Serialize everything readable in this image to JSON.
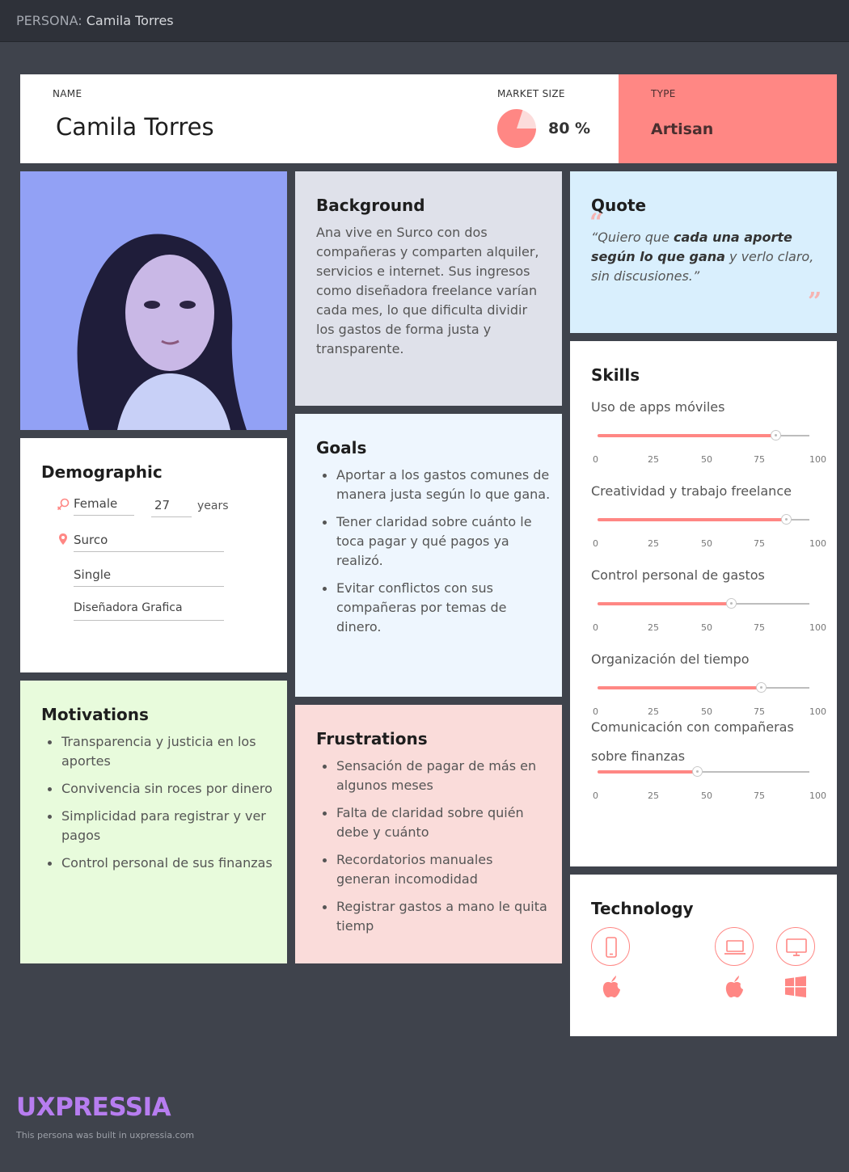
{
  "topbar": {
    "prefix": "PERSONA:",
    "name": "Camila Torres"
  },
  "header": {
    "name_label": "NAME",
    "name_value": "Camila Torres",
    "market_label": "MARKET SIZE",
    "market_value": "80 %",
    "market_percent": 80,
    "type_label": "TYPE",
    "type_value": "Artisan"
  },
  "background": {
    "title": "Background",
    "text": "Ana vive en Surco con dos compañeras y comparten alquiler, servicios e internet. Sus ingresos como diseñadora freelance varían cada mes, lo que dificulta dividir los gastos de forma justa y transparente."
  },
  "quote": {
    "title": "Quote",
    "part1": "“Quiero que ",
    "bold": "cada una aporte según lo que gana",
    "part2": " y verlo claro, sin discusiones.”"
  },
  "demographic": {
    "title": "Demographic",
    "gender": "Female",
    "age": "27",
    "age_unit": "years",
    "location": "Surco",
    "status": "Single",
    "occupation": "Diseñadora Grafica"
  },
  "goals": {
    "title": "Goals",
    "items": [
      "Aportar a los gastos comunes de manera justa según lo que gana.",
      "Tener claridad sobre cuánto le toca pagar y qué pagos ya realizó.",
      "Evitar conflictos con sus compañeras por temas de dinero."
    ]
  },
  "skills": {
    "title": "Skills",
    "ticks": [
      "0",
      "25",
      "50",
      "75",
      "100"
    ],
    "items": [
      {
        "label": "Uso de apps móviles",
        "value": 84
      },
      {
        "label": "Creatividad y trabajo freelance",
        "value": 89
      },
      {
        "label": "Control personal de gastos",
        "value": 63
      },
      {
        "label": "Organización del tiempo",
        "value": 77
      },
      {
        "label": "Comunicación con compañeras sobre finanzas",
        "value": 47
      }
    ]
  },
  "motivations": {
    "title": "Motivations",
    "items": [
      "Transparencia y justicia en los aportes",
      "Convivencia sin roces por dinero",
      "Simplicidad para registrar y ver pagos",
      "Control personal de sus finanzas"
    ]
  },
  "frustrations": {
    "title": "Frustrations",
    "items": [
      "Sensación de pagar de más en algunos meses",
      "Falta de claridad sobre quién debe y cuánto",
      "Recordatorios manuales generan incomodidad",
      "Registrar gastos a mano le quita tiemp"
    ]
  },
  "technology": {
    "title": "Technology",
    "devices": [
      "mobile-phone-icon",
      "laptop-icon",
      "desktop-monitor-icon"
    ],
    "platforms": [
      "apple-icon",
      "apple-icon",
      "windows-icon"
    ]
  },
  "footer": {
    "brand": "UXPRESSIA",
    "note": "This persona was built in uxpressia.com"
  },
  "colors": {
    "accent": "#ff8784",
    "background_card": "#dfe1ea",
    "quote_card": "#d9effd",
    "goals_card": "#eef6fe",
    "motivations_card": "#e8fbdc",
    "frustrations_card": "#fadcda",
    "brand": "#b77df0"
  }
}
